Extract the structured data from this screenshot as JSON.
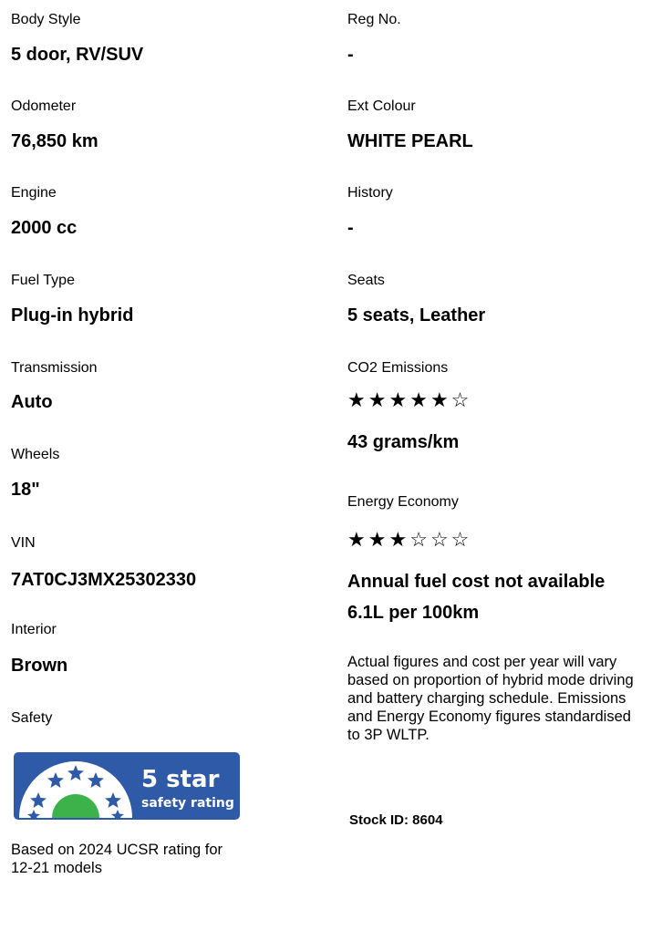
{
  "left": {
    "body_style": {
      "label": "Body Style",
      "value": "5 door, RV/SUV"
    },
    "odometer": {
      "label": "Odometer",
      "value": "76,850 km"
    },
    "engine": {
      "label": "Engine",
      "value": "2000 cc"
    },
    "fuel_type": {
      "label": "Fuel Type",
      "value": "Plug-in hybrid"
    },
    "transmission": {
      "label": "Transmission",
      "value": "Auto"
    },
    "wheels": {
      "label": "Wheels",
      "value": "18\""
    },
    "vin": {
      "label": "VIN",
      "value": "7AT0CJ3MX25302330"
    },
    "interior": {
      "label": "Interior",
      "value": "Brown"
    },
    "safety": {
      "label": "Safety",
      "badge_rating": "5 star",
      "badge_sub": "safety rating",
      "badge_color": "#2f5aa8",
      "badge_star_color": "#2f5aa8",
      "badge_dome_color": "#3db24a",
      "based_on": "Based on 2024 UCSR rating for 12-21 models"
    }
  },
  "right": {
    "reg_no": {
      "label": "Reg No.",
      "value": "-"
    },
    "ext_colour": {
      "label": "Ext Colour",
      "value": "WHITE PEARL"
    },
    "history": {
      "label": "History",
      "value": "-"
    },
    "seats": {
      "label": "Seats",
      "value": "5 seats, Leather"
    },
    "co2": {
      "label": "CO2 Emissions",
      "stars_filled": 5,
      "stars_total": 6,
      "value": "43 grams/km"
    },
    "energy": {
      "label": "Energy Economy",
      "stars_filled": 3,
      "stars_total": 6,
      "fuel_cost": "Annual fuel cost not available",
      "consumption": "6.1L per 100km"
    },
    "note": "Actual figures and cost per year will vary based on proportion of hybrid mode driving and battery charging schedule. Emissions and Energy Economy figures standardised to 3P WLTP.",
    "stock_id": "Stock ID: 8604"
  }
}
